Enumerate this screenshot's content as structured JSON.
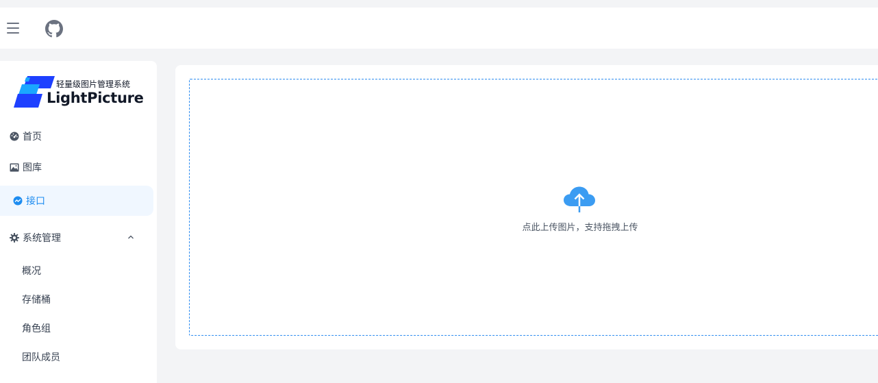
{
  "header": {
    "menu_icon": "hamburger-menu-icon",
    "github_icon": "github-icon"
  },
  "logo": {
    "subtitle": "轻量级图片管理系统",
    "title": "LightPicture"
  },
  "sidebar": {
    "items": [
      {
        "label": "首页",
        "icon": "dashboard-icon"
      },
      {
        "label": "图库",
        "icon": "image-icon"
      },
      {
        "label": "接口",
        "icon": "api-icon",
        "active": true
      },
      {
        "label": "系统管理",
        "icon": "gear-icon",
        "expanded": true
      }
    ],
    "sub_items": [
      {
        "label": "概况"
      },
      {
        "label": "存储桶"
      },
      {
        "label": "角色组"
      },
      {
        "label": "团队成员"
      }
    ]
  },
  "main": {
    "upload_icon": "cloud-upload-icon",
    "upload_text": "点此上传图片，支持拖拽上传"
  },
  "colors": {
    "accent": "#1d8cf0",
    "active_bg": "#f0f7ff",
    "page_bg": "#f3f4f6",
    "logo_blue": "#1e40ff"
  }
}
